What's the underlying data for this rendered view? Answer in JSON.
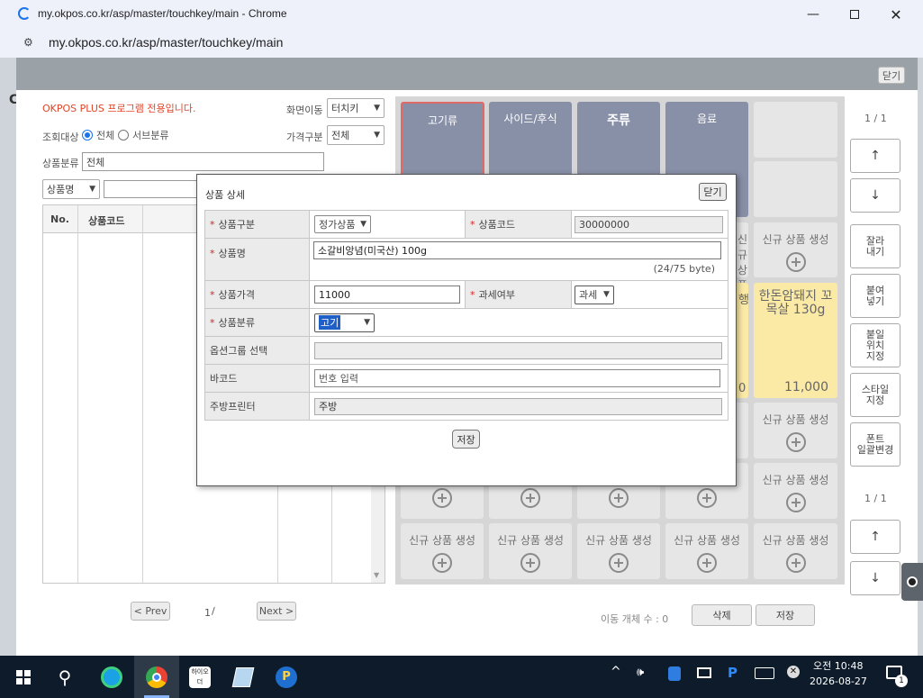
{
  "window": {
    "title": "my.okpos.co.kr/asp/master/touchkey/main - Chrome",
    "url": "my.okpos.co.kr/asp/master/touchkey/main",
    "close_top": "닫기"
  },
  "left_panel": {
    "notice": "OKPOS PLUS 프로그램 전용입니다.",
    "view_target_label": "조회대상",
    "radio_all": "전체",
    "radio_sub": "서브분류",
    "screen_move_label": "화면이동",
    "screen_move_value": "터치키",
    "price_type_label": "가격구분",
    "price_type_value": "전체",
    "category_label": "상품분류",
    "category_value": "전체",
    "search_select": "상품명",
    "col_no": "No.",
    "col_code": "상품코드",
    "prev": "< Prev",
    "next": "Next >",
    "page_current": "1",
    "page_sep": "/"
  },
  "categories": [
    "고기류",
    "사이드/후식",
    "주류",
    "음료"
  ],
  "touchkeys": {
    "new_label": "신규 상품 생성",
    "partial_left": "행",
    "partial_left2": "0",
    "product_name": "한돈암돼지 꼬목살 130g",
    "product_price": "11,000"
  },
  "side": {
    "page_top": "1 / 1",
    "page_bottom": "1 / 1",
    "cut": "잘라\n내기",
    "paste": "붙여\n넣기",
    "place": "붙일\n위치\n지정",
    "style": "스타일\n지정",
    "font": "폰트\n일괄변경"
  },
  "bottom": {
    "move_count": "이동 개체 수 : 0",
    "delete": "삭제",
    "save": "저장"
  },
  "modal": {
    "title": "상품 상세",
    "close": "닫기",
    "product_type_label": "상품구분",
    "product_type_value": "정가상품",
    "product_code_label": "상품코드",
    "product_code_value": "30000000",
    "product_name_label": "상품명",
    "product_name_value": "소갈비앙념(미국산) 100g",
    "byte_count": "(24/75 byte)",
    "price_label": "상품가격",
    "price_value": "11000",
    "tax_label": "과세여부",
    "tax_value": "과세",
    "category_label": "상품분류",
    "category_value": "고기",
    "option_group_label": "옵션그룹 선택",
    "barcode_label": "바코드",
    "barcode_placeholder": "번호 입력",
    "kitchen_printer_label": "주방프린터",
    "kitchen_printer_value": "주방",
    "save": "저장"
  },
  "taskbar": {
    "ime": "P",
    "time": "오전 10:48",
    "date": "2026-08-27",
    "notif": "1",
    "app_label": "하이오더"
  }
}
